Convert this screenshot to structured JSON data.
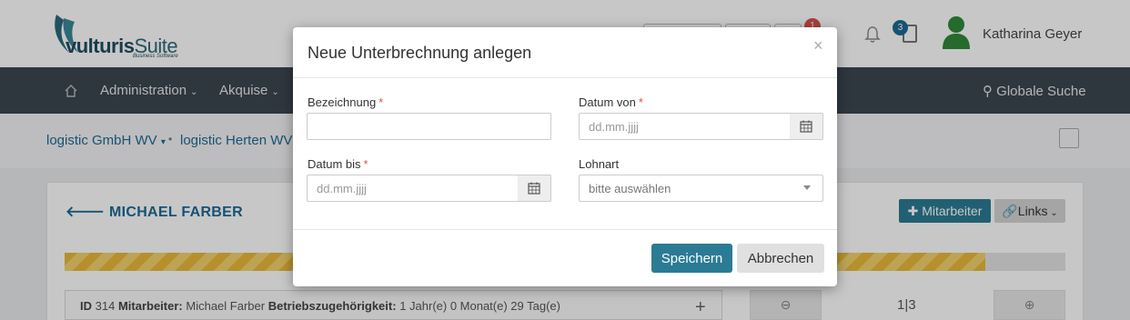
{
  "app": {
    "logo_text": "vulturis",
    "logo_suite": "Suite",
    "logo_subtitle": "Business Software",
    "notification_count": "3",
    "notification_red_count": "1",
    "user_name": "Katharina Geyer"
  },
  "nav": {
    "items": [
      {
        "label": "Administration"
      },
      {
        "label": "Akquise"
      }
    ],
    "search_label": "Globale Suche"
  },
  "breadcrumb": {
    "items": [
      "logistic GmbH WV",
      "logistic Herten WV"
    ]
  },
  "employee": {
    "title": "MICHAEL FARBER",
    "add_button": "Mitarbeiter",
    "links_button": "Links",
    "progress_percent": 92,
    "info": {
      "id_label": "ID",
      "id_value": "314",
      "mitarbeiter_label": "Mitarbeiter:",
      "mitarbeiter_value": "Michael Farber",
      "zugehoerigkeit_label": "Betriebszugehörigkeit:",
      "zugehoerigkeit_value": "1 Jahr(e) 0 Monat(e) 29 Tag(e)"
    },
    "pager": "1|3"
  },
  "modal": {
    "title": "Neue Unterbrechnung anlegen",
    "close_symbol": "×",
    "fields": {
      "bezeichnung": {
        "label": "Bezeichnung",
        "required": "*",
        "value": "",
        "placeholder": ""
      },
      "datum_von": {
        "label": "Datum von",
        "required": "*",
        "value": "",
        "placeholder": "dd.mm.jjjj"
      },
      "datum_bis": {
        "label": "Datum bis",
        "required": "*",
        "value": "",
        "placeholder": "dd.mm.jjjj"
      },
      "lohnart": {
        "label": "Lohnart",
        "selected": "bitte auswählen"
      }
    },
    "save_label": "Speichern",
    "cancel_label": "Abbrechen"
  },
  "colors": {
    "primary": "#2b7b94",
    "navbar": "#3c4650",
    "link": "#1e6a93",
    "required": "#d9534f",
    "progress": "#e8b93a"
  }
}
